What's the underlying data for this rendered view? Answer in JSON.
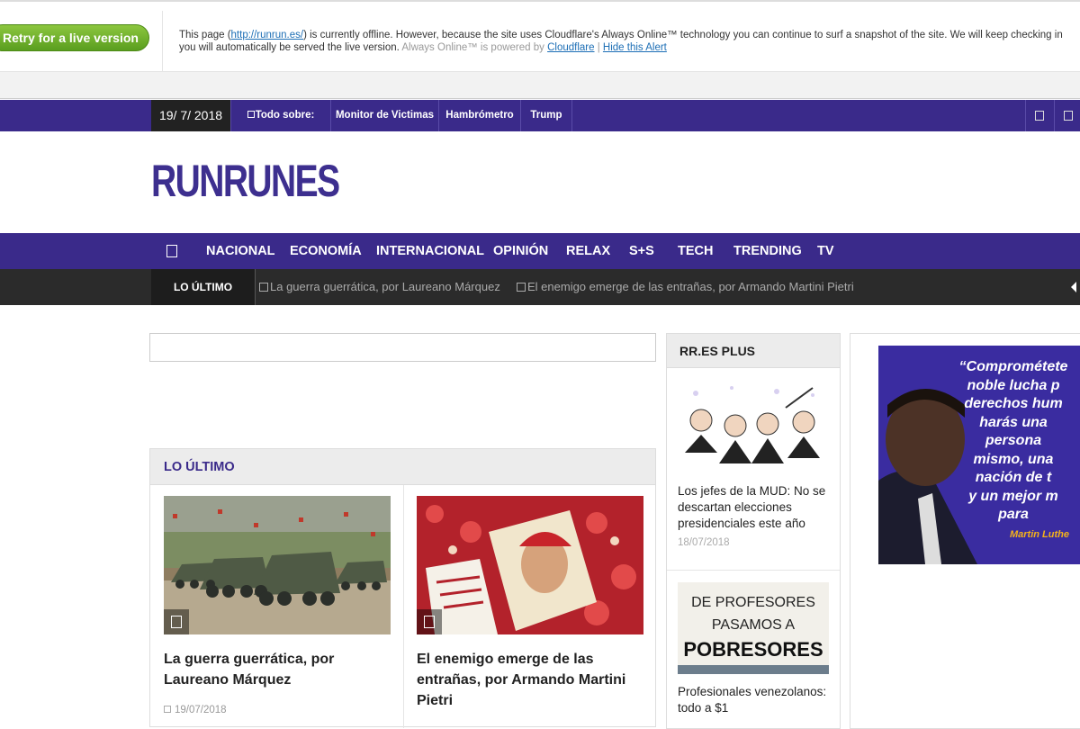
{
  "cloudflare": {
    "retry_label": "Retry for a live version",
    "message_a": "This page (",
    "url": "http://runrun.es/",
    "message_b": ") is currently offline. However, because the site uses Cloudflare's Always Online™ technology you can continue to surf a snapshot of the site. We will keep checking in",
    "message_c": "you will automatically be served the live version.",
    "powered_by": "Always Online™ is powered by",
    "cloudflare_link": "Cloudflare",
    "separator": "|",
    "hide_link": "Hide this Alert"
  },
  "topbar": {
    "date": "19/ 7/ 2018",
    "todo_sobre": "Todo sobre:",
    "links": [
      "Monitor de Victimas",
      "Hambrómetro",
      "Trump"
    ]
  },
  "logo": "RUNRUNES",
  "mainnav": {
    "items": [
      "NACIONAL",
      "ECONOMÍA",
      "INTERNACIONAL",
      "OPINIÓN",
      "RELAX",
      "S+S",
      "TECH",
      "TRENDING",
      "TV"
    ]
  },
  "ticker": {
    "label": "LO ÚLTIMO",
    "items": [
      "La guerra guerrática, por Laureano Márquez",
      "El enemigo emerge de las entrañas, por Armando Martini Pietri"
    ]
  },
  "section": {
    "title": "LO ÚLTIMO",
    "cards": [
      {
        "title": "La guerra guerrática, por Laureano Márquez",
        "date": "19/07/2018"
      },
      {
        "title": "El enemigo emerge de las entrañas, por Armando Martini Pietri"
      }
    ]
  },
  "plus": {
    "title": "RR.ES PLUS",
    "items": [
      {
        "title": "Los jefes de la MUD: No se descartan elecciones presidenciales este año",
        "date": "18/07/2018"
      },
      {
        "title": "Profesionales venezolanos: todo a $1"
      }
    ],
    "sign_lines": [
      "DE PROFESORES",
      "PASAMOS A",
      "POBRESORES"
    ]
  },
  "ad": {
    "quote_lines": [
      "“Comprométete",
      "noble lucha p",
      "derechos hum",
      "harás una",
      "persona",
      "mismo, una",
      "nación de t",
      "y un mejor m",
      "para"
    ],
    "author": "Martin Luthe"
  }
}
